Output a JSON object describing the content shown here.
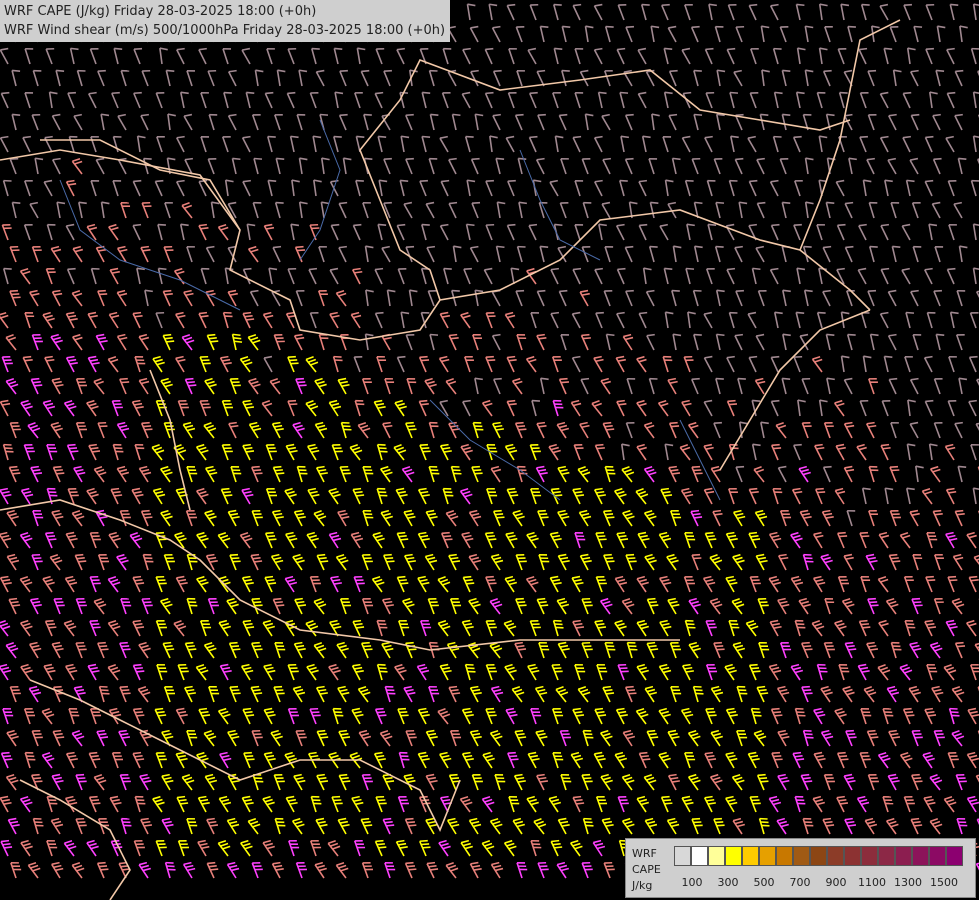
{
  "header": {
    "line1": "WRF CAPE (J/kg) Friday 28-03-2025 18:00 (+0h)",
    "line2": "WRF Wind shear (m/s) 500/1000hPa Friday 28-03-2025 18:00 (+0h)"
  },
  "legend": {
    "label_line1": "WRF",
    "label_line2": "CAPE",
    "label_line3": "J/kg",
    "colors": [
      "#d8d8d8",
      "#ffffff",
      "#ffff99",
      "#ffff00",
      "#ffcc00",
      "#e6a000",
      "#c87800",
      "#a05a14",
      "#8c4614",
      "#8c3c28",
      "#8c3232",
      "#8c2d3c",
      "#8c2846",
      "#8c1e50",
      "#8c145a",
      "#8c0a64",
      "#8c0070"
    ],
    "ticks": [
      "100",
      "300",
      "500",
      "700",
      "900",
      "1100",
      "1300",
      "1500"
    ]
  },
  "barb_colors": {
    "low_shear": "#a08890",
    "moderate_shear": "#e8807a",
    "high_shear": "#ff40ff",
    "cape_highlight": "#ffff00"
  }
}
